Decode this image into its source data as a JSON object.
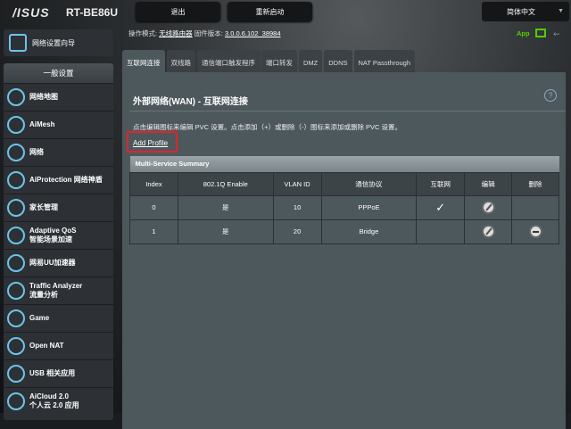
{
  "header": {
    "logo": "/ISUS",
    "model": "RT-BE86U",
    "logout": "退出",
    "reboot": "重新启动",
    "language": "简体中文"
  },
  "status": {
    "mode_label": "操作模式:",
    "mode_value": "无线路由器",
    "fw_label": "固件版本:",
    "fw_value": "3.0.0.6.102_38984",
    "app": "App"
  },
  "sidebar": {
    "wizard": "网络设置向导",
    "section": "一般设置",
    "items": [
      {
        "label": "网络地图"
      },
      {
        "label": "AiMesh"
      },
      {
        "label": "网络"
      },
      {
        "label": "AiProtection 网络神盾"
      },
      {
        "label": "家长管理"
      },
      {
        "label": "Adaptive QoS",
        "sub": "智能场景加速"
      },
      {
        "label": "网易UU加速器"
      },
      {
        "label": "Traffic Analyzer",
        "sub": "流量分析"
      },
      {
        "label": "Game"
      },
      {
        "label": "Open NAT"
      },
      {
        "label": "USB 相关应用"
      },
      {
        "label": "AiCloud 2.0",
        "sub": "个人云 2.0 应用"
      }
    ]
  },
  "tabs": [
    "互联网连接",
    "双线路",
    "通信端口触发程序",
    "端口转发",
    "DMZ",
    "DDNS",
    "NAT Passthrough"
  ],
  "main": {
    "title": "外部网络(WAN) - 互联网连接",
    "help": "?",
    "description": "点击编辑图标来编辑 PVC 设置。点击添加（+）或删除（-）图标来添加或删除 PVC 设置。",
    "add_profile": "Add Profile",
    "table": {
      "caption": "Multi-Service Summary",
      "headers": [
        "Index",
        "802.1Q Enable",
        "VLAN ID",
        "通信协议",
        "互联网",
        "编辑",
        "删除"
      ],
      "rows": [
        {
          "index": "0",
          "enable": "是",
          "vlan": "10",
          "protocol": "PPPoE",
          "internet": "✓",
          "deletable": false
        },
        {
          "index": "1",
          "enable": "是",
          "vlan": "20",
          "protocol": "Bridge",
          "internet": "",
          "deletable": true
        }
      ]
    }
  }
}
